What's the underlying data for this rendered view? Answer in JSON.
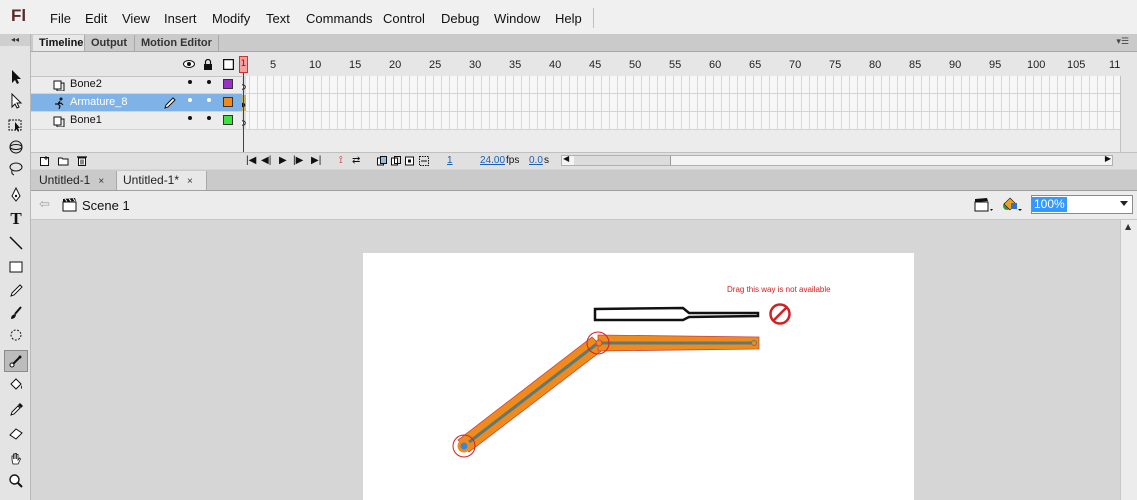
{
  "app": {
    "logo": "Fl"
  },
  "menu": [
    "File",
    "Edit",
    "View",
    "Insert",
    "Modify",
    "Text",
    "Commands",
    "Control",
    "Debug",
    "Window",
    "Help"
  ],
  "panel_tabs": [
    "Timeline",
    "Output",
    "Motion Editor"
  ],
  "timeline": {
    "ruler": [
      "1",
      "5",
      "10",
      "15",
      "20",
      "25",
      "30",
      "35",
      "40",
      "45",
      "50",
      "55",
      "60",
      "65",
      "70",
      "75",
      "80",
      "85",
      "90",
      "95",
      "100",
      "105",
      "11"
    ],
    "layers": [
      {
        "name": "Bone2",
        "color": "#9b30c9",
        "selected": false
      },
      {
        "name": "Armature_8",
        "color": "#f08a1a",
        "selected": true
      },
      {
        "name": "Bone1",
        "color": "#3ee23e",
        "selected": false
      }
    ],
    "footer": {
      "frame": "1",
      "fps": "24.00",
      "fps_unit": "fps",
      "time": "0.0",
      "time_unit": "s"
    }
  },
  "doc_tabs": [
    {
      "label": "Untitled-1",
      "close": "×",
      "active": false
    },
    {
      "label": "Untitled-1*",
      "close": "×",
      "active": true
    }
  ],
  "edit_bar": {
    "scene": "Scene 1",
    "zoom": "100%"
  },
  "stage": {
    "warning": "Drag this way is not available"
  },
  "colors": {
    "bone": "#f08a1a",
    "warning": "#d42020",
    "selection": "#7fb3e8"
  }
}
